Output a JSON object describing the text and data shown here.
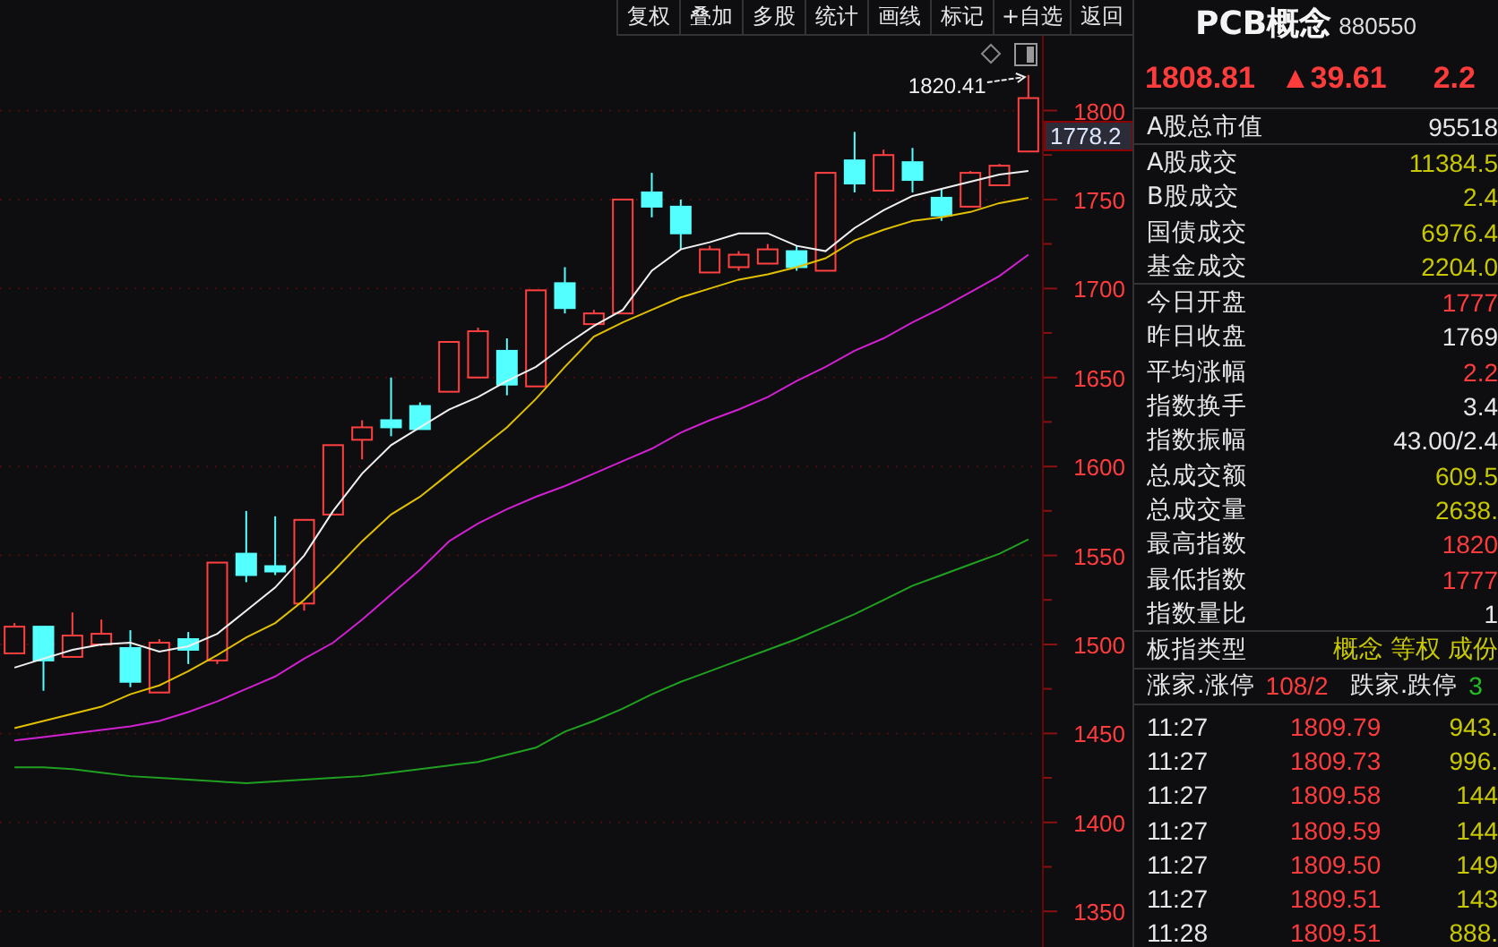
{
  "toolbar": [
    {
      "label": "复权"
    },
    {
      "label": "叠加"
    },
    {
      "label": "多股"
    },
    {
      "label": "统计"
    },
    {
      "label": "画线"
    },
    {
      "label": "标记"
    },
    {
      "label": "+自选"
    },
    {
      "label": "返回"
    }
  ],
  "chart": {
    "current_price": "1778.2",
    "high_marker": "1820.41",
    "chart_data": {
      "type": "candlestick",
      "grid": true,
      "ylim": [
        1330,
        1842
      ],
      "yticks": [
        1800,
        1750,
        1700,
        1650,
        1600,
        1550,
        1500,
        1450,
        1400,
        1350
      ],
      "categories": [
        null,
        null,
        null,
        null,
        null,
        null,
        null,
        null,
        null,
        null,
        null,
        null,
        null,
        null,
        null,
        null,
        null,
        null,
        null,
        null,
        null,
        null,
        null,
        null,
        null,
        null,
        null,
        null,
        null,
        null,
        null,
        null,
        null,
        null,
        null,
        null
      ],
      "ohlc": [
        [
          1495,
          1512,
          1495,
          1510
        ],
        [
          1510,
          1510,
          1474,
          1491
        ],
        [
          1493,
          1518,
          1493,
          1505
        ],
        [
          1500,
          1514,
          1499,
          1506
        ],
        [
          1498,
          1508,
          1476,
          1479
        ],
        [
          1473,
          1503,
          1473,
          1501
        ],
        [
          1503,
          1507,
          1489,
          1497
        ],
        [
          1491,
          1546,
          1489,
          1546
        ],
        [
          1551,
          1575,
          1535,
          1539
        ],
        [
          1544,
          1572,
          1539,
          1541
        ],
        [
          1523,
          1570,
          1519,
          1570
        ],
        [
          1573,
          1612,
          1573,
          1612
        ],
        [
          1615,
          1626,
          1604,
          1622
        ],
        [
          1626,
          1650,
          1617,
          1622
        ],
        [
          1634,
          1636,
          1621,
          1621
        ],
        [
          1642,
          1670,
          1642,
          1670
        ],
        [
          1650,
          1678,
          1650,
          1676
        ],
        [
          1665,
          1672,
          1640,
          1646
        ],
        [
          1645,
          1699,
          1645,
          1699
        ],
        [
          1703,
          1712,
          1686,
          1689
        ],
        [
          1680,
          1688,
          1680,
          1686
        ],
        [
          1686,
          1750,
          1686,
          1750
        ],
        [
          1754,
          1765,
          1740,
          1746
        ],
        [
          1746,
          1750,
          1722,
          1731
        ],
        [
          1709,
          1724,
          1709,
          1722
        ],
        [
          1712,
          1721,
          1710,
          1719
        ],
        [
          1714,
          1725,
          1714,
          1722
        ],
        [
          1721,
          1724,
          1710,
          1712
        ],
        [
          1710,
          1765,
          1710,
          1765
        ],
        [
          1772,
          1788,
          1754,
          1759
        ],
        [
          1755,
          1778,
          1755,
          1775
        ],
        [
          1771,
          1779,
          1754,
          1761
        ],
        [
          1751,
          1756,
          1738,
          1741
        ],
        [
          1746,
          1766,
          1746,
          1765
        ],
        [
          1758,
          1770,
          1758,
          1769
        ],
        [
          1777,
          1820,
          1777,
          1807
        ]
      ],
      "series": [
        {
          "type": "line",
          "color": "#f0f0f0",
          "values": [
            1487,
            1492,
            1497,
            1500,
            1501,
            1496,
            1499,
            1506,
            1519,
            1532,
            1550,
            1575,
            1596,
            1612,
            1622,
            1632,
            1639,
            1648,
            1656,
            1668,
            1679,
            1688,
            1710,
            1722,
            1726,
            1731,
            1731,
            1724,
            1721,
            1734,
            1744,
            1752,
            1756,
            1760,
            1764,
            1766
          ]
        },
        {
          "type": "line",
          "color": "#e0c000",
          "values": [
            1453,
            1457,
            1461,
            1465,
            1472,
            1477,
            1485,
            1494,
            1504,
            1512,
            1525,
            1541,
            1558,
            1573,
            1583,
            1596,
            1609,
            1622,
            1638,
            1656,
            1673,
            1681,
            1688,
            1695,
            1700,
            1705,
            1708,
            1712,
            1717,
            1727,
            1733,
            1738,
            1740,
            1743,
            1748,
            1751
          ]
        },
        {
          "type": "line",
          "color": "#d020d0",
          "values": [
            1446,
            1448,
            1450,
            1452,
            1454,
            1457,
            1462,
            1468,
            1475,
            1482,
            1492,
            1501,
            1514,
            1528,
            1542,
            1558,
            1568,
            1576,
            1583,
            1589,
            1596,
            1603,
            1610,
            1619,
            1626,
            1632,
            1639,
            1648,
            1656,
            1665,
            1672,
            1681,
            1689,
            1698,
            1707,
            1719
          ]
        },
        {
          "type": "line",
          "color": "#20a020",
          "values": [
            1431,
            1431,
            1430,
            1428,
            1426,
            1425,
            1424,
            1423,
            1422,
            1423,
            1424,
            1425,
            1426,
            1428,
            1430,
            1432,
            1434,
            1438,
            1442,
            1451,
            1457,
            1464,
            1472,
            1479,
            1485,
            1491,
            1497,
            1503,
            1510,
            1517,
            1525,
            1533,
            1539,
            1545,
            1551,
            1559
          ]
        }
      ]
    }
  },
  "quote": {
    "name": "PCB概念",
    "code": "880550",
    "price": "1808.81",
    "change": "▲39.61",
    "change_pct": "2.2"
  },
  "stats": [
    {
      "rows": [
        {
          "label": "A股总市值",
          "value": "95518",
          "color": "#e6e6e6"
        }
      ]
    },
    {
      "rows": [
        {
          "label": "A股成交",
          "value": "11384.5",
          "color": "#c8c800"
        },
        {
          "label": "B股成交",
          "value": "2.4",
          "color": "#c8c800"
        },
        {
          "label": "国债成交",
          "value": "6976.4",
          "color": "#c8c800"
        },
        {
          "label": "基金成交",
          "value": "2204.0",
          "color": "#c8c800"
        }
      ]
    },
    {
      "rows": [
        {
          "label": "今日开盘",
          "value": "1777",
          "color": "#ff3c3c"
        },
        {
          "label": "昨日收盘",
          "value": "1769",
          "color": "#e6e6e6"
        },
        {
          "label": "平均涨幅",
          "value": "2.2",
          "color": "#ff3c3c"
        },
        {
          "label": "指数换手",
          "value": "3.4",
          "color": "#e6e6e6"
        },
        {
          "label": "指数振幅",
          "value": "43.00/2.4",
          "color": "#e6e6e6"
        },
        {
          "label": "总成交额",
          "value": "609.5",
          "color": "#c8c800"
        },
        {
          "label": "总成交量",
          "value": "2638.",
          "color": "#c8c800"
        },
        {
          "label": "最高指数",
          "value": "1820",
          "color": "#ff3c3c"
        },
        {
          "label": "最低指数",
          "value": "1777",
          "color": "#ff3c3c"
        },
        {
          "label": "指数量比",
          "value": "1",
          "color": "#e6e6e6"
        }
      ]
    },
    {
      "rows": [
        {
          "label": "板指类型",
          "value": "概念 等权 成份",
          "color": "#c8c800"
        }
      ]
    }
  ],
  "breadth": {
    "up_label": "涨家.涨停",
    "up_value": "108/2",
    "down_label": "跌家.跌停",
    "down_value": "3"
  },
  "ticks": [
    {
      "time": "11:27",
      "price": "1809.79",
      "volume": "943."
    },
    {
      "time": "11:27",
      "price": "1809.73",
      "volume": "996."
    },
    {
      "time": "11:27",
      "price": "1809.58",
      "volume": "144"
    },
    {
      "time": "11:27",
      "price": "1809.59",
      "volume": "144"
    },
    {
      "time": "11:27",
      "price": "1809.50",
      "volume": "149"
    },
    {
      "time": "11:27",
      "price": "1809.51",
      "volume": "143"
    },
    {
      "time": "11:28",
      "price": "1809.51",
      "volume": "888."
    }
  ]
}
